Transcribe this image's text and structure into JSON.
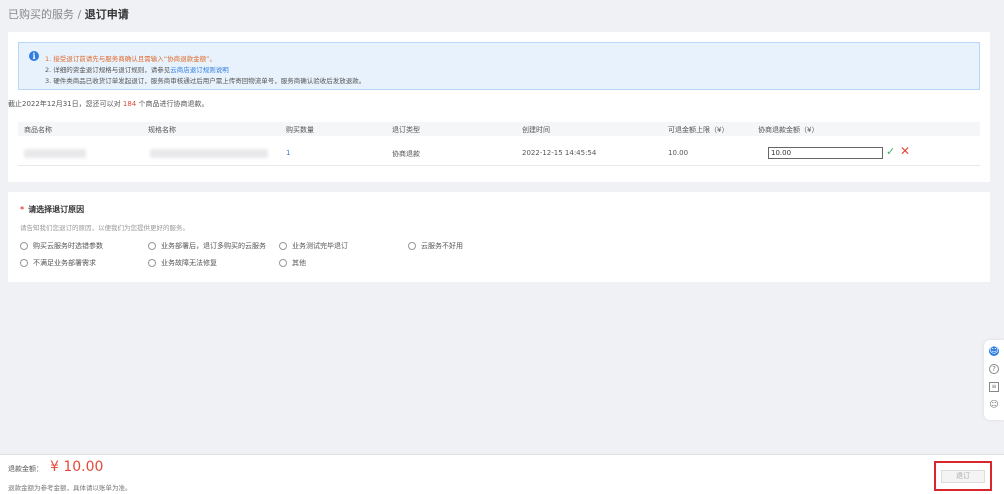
{
  "breadcrumb": {
    "parent": "已购买的服务",
    "separator": " / ",
    "current": "退订申请"
  },
  "notice": {
    "line1": "1. 接受退订前请先与服务商确认且需输入“协商退款金额”。",
    "line2_prefix": "2. 详细的资金退订规格与退订规则，请参见",
    "line2_link": "云商店退订规则说明",
    "line3": "3. 硬件类商品已收货订单发起退订，服务商审核通过后用户需上传寄回物流单号，服务商确认验收后发放退款。"
  },
  "quota": {
    "prefix": "截止2022年12月31日，您还可以对 ",
    "count": "184",
    "suffix": " 个商品进行协商退款。"
  },
  "table": {
    "headers": [
      "商品名称",
      "规格名称",
      "购买数量",
      "退订类型",
      "创建时间",
      "可退金额上限（¥）",
      "协商退款金额（¥）"
    ],
    "row": {
      "quantity": "1",
      "type": "协商退款",
      "created": "2022-12-15 14:45:54",
      "max_refund": "10.00",
      "negotiated": "10.00"
    }
  },
  "reason": {
    "required_mark": "*",
    "title": "请选择退订原因",
    "subtitle": "请告知我们您退订的原因，以便我们为您提供更好的服务。",
    "options": [
      "购买云服务时选错参数",
      "业务部署后，退订多购买的云服务",
      "业务测试完毕退订",
      "云服务不好用",
      "不满足业务部署需求",
      "业务故障无法修复",
      "其他"
    ]
  },
  "footer": {
    "refund_label": "退款金额：",
    "refund_amount": "¥ 10.00",
    "note": "退款金额为参考金额，具体请以账单为准。",
    "submit": "退订"
  },
  "icons": {
    "info": "info-icon",
    "confirm": "check-icon",
    "cancel": "close-icon"
  },
  "colors": {
    "accent": "#2f7de1",
    "danger": "#e24a3a",
    "success": "#3ab76a"
  }
}
